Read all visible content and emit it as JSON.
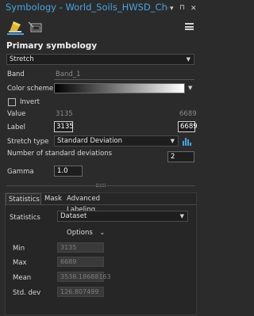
{
  "window": {
    "title": "Symbology - World_Soils_HWSD_Chemi...",
    "menu_glyph": "▾",
    "pin_glyph": "⊓",
    "close_glyph": "✕"
  },
  "section": {
    "primary_symbology": "Primary symbology"
  },
  "renderer": {
    "value": "Stretch"
  },
  "band": {
    "label": "Band",
    "value": "Band_1"
  },
  "color_scheme": {
    "label": "Color scheme"
  },
  "invert": {
    "label": "Invert",
    "checked": false
  },
  "value_row": {
    "label": "Value",
    "min": "3135",
    "max": "6689"
  },
  "label_row": {
    "label": "Label",
    "min": "3135",
    "max": "6689"
  },
  "stretch_type": {
    "label": "Stretch type",
    "value": "Standard Deviation"
  },
  "std_devs": {
    "label": "Number of standard deviations",
    "value": "2"
  },
  "gamma": {
    "label": "Gamma",
    "value": "1.0"
  },
  "tabs": [
    {
      "label": "Statistics",
      "active": true
    },
    {
      "label": "Mask",
      "active": false
    },
    {
      "label": "Advanced Labeling",
      "active": false
    }
  ],
  "statistics": {
    "label": "Statistics",
    "value": "Dataset",
    "options_label": "Options",
    "rows": [
      {
        "label": "Min",
        "value": "3135"
      },
      {
        "label": "Max",
        "value": "6689"
      },
      {
        "label": "Mean",
        "value": "3538.18688163"
      },
      {
        "label": "Std. dev",
        "value": "126.807499"
      }
    ]
  },
  "colors": {
    "accent": "#4aa3df",
    "background": "#2b2b2b"
  }
}
